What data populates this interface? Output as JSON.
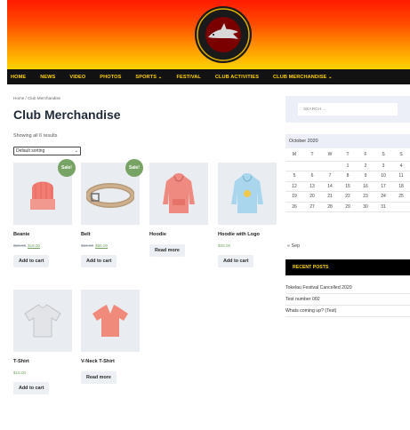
{
  "nav": {
    "items": [
      {
        "label": "HOME"
      },
      {
        "label": "NEWS"
      },
      {
        "label": "VIDEO"
      },
      {
        "label": "PHOTOS"
      },
      {
        "label": "SPORTS ⌄"
      },
      {
        "label": "FESTIVAL"
      },
      {
        "label": "CLUB ACTIVITIES"
      },
      {
        "label": "CLUB MERCHANDISE ⌄"
      }
    ]
  },
  "breadcrumb": "Home / Club Merchandise",
  "page_title": "Club Merchandise",
  "results_count": "Showing all 6 results",
  "sort": {
    "selected": "Default sorting"
  },
  "products": [
    {
      "name": "Beanie",
      "old_price": "$20.00",
      "price": "$18.00",
      "sale": "Sale!",
      "button": "Add to cart"
    },
    {
      "name": "Belt",
      "old_price": "$65.00",
      "price": "$55.00",
      "sale": "Sale!",
      "button": "Add to cart"
    },
    {
      "name": "Hoodie",
      "button": "Read more"
    },
    {
      "name": "Hoodie with Logo",
      "price": "$45.00",
      "button": "Add to cart"
    },
    {
      "name": "T-Shirt",
      "price": "$18.00",
      "button": "Add to cart"
    },
    {
      "name": "V-Neck T-Shirt",
      "button": "Read more"
    }
  ],
  "sidebar": {
    "search_placeholder": "SEARCH ...",
    "calendar": {
      "caption": "October 2020",
      "weekdays": [
        "M",
        "T",
        "W",
        "T",
        "F",
        "S",
        "S"
      ],
      "weeks": [
        [
          "",
          "",
          "",
          "1",
          "2",
          "3",
          "4"
        ],
        [
          "5",
          "6",
          "7",
          "8",
          "9",
          "10",
          "11"
        ],
        [
          "12",
          "13",
          "14",
          "15",
          "16",
          "17",
          "18"
        ],
        [
          "19",
          "20",
          "21",
          "22",
          "23",
          "24",
          "25"
        ],
        [
          "26",
          "27",
          "28",
          "29",
          "30",
          "31",
          ""
        ]
      ],
      "prev": "« Sep"
    },
    "recent_posts_title": "RECENT POSTS",
    "recent_posts": [
      "Tokelau Festival Cancelled 2020",
      "Test number 002",
      "Whats coming up? (Test)"
    ]
  },
  "colors": {
    "nav_bg": "#121212",
    "nav_text": "#ffd400",
    "sale_badge": "#77a464",
    "banner_top": "#ff1a00",
    "banner_bottom": "#ffd200"
  }
}
